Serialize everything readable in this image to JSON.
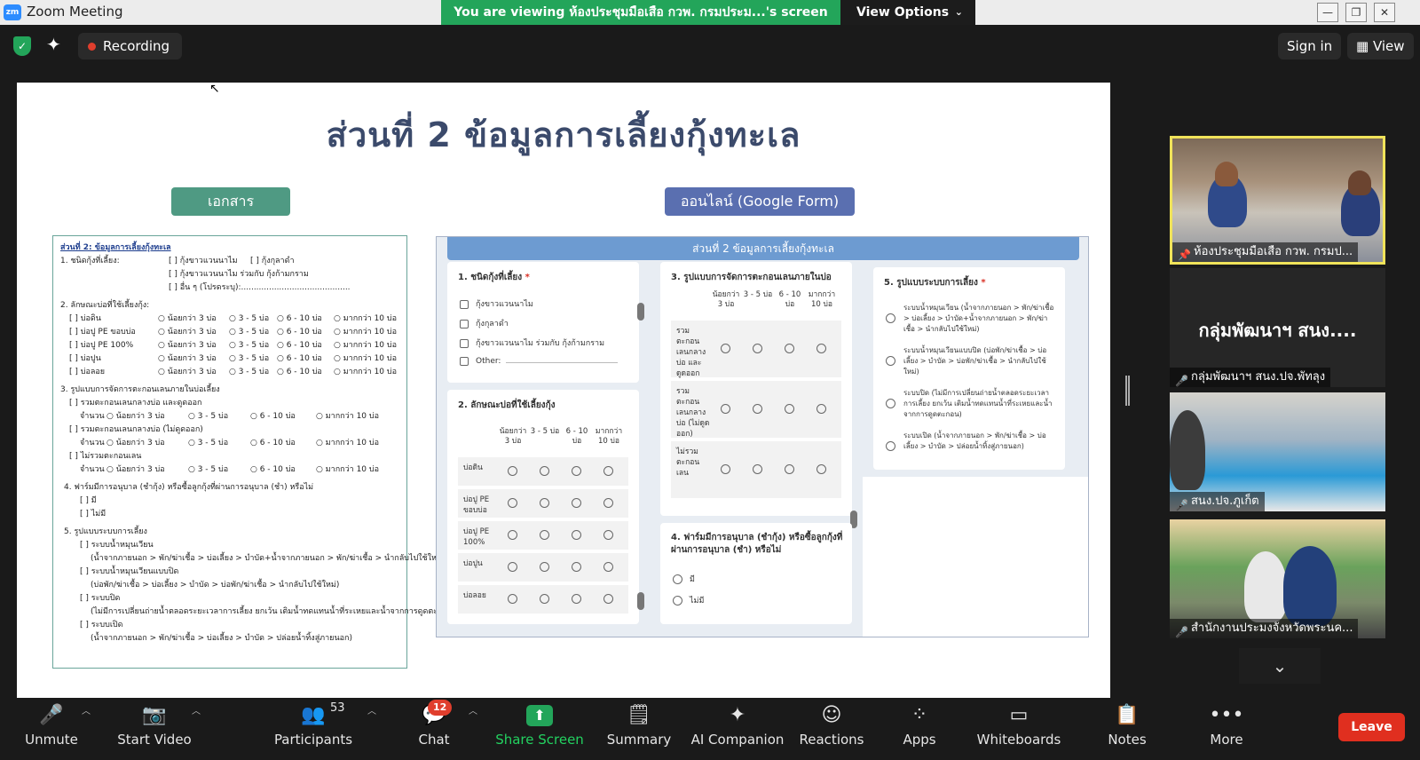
{
  "window": {
    "title": "Zoom Meeting",
    "banner": "You are viewing ห้องประชุมมือเสือ กวพ. กรมประม...'s screen",
    "view_options": "View Options"
  },
  "topbar": {
    "recording": "Recording",
    "sign_in": "Sign in",
    "view": "View"
  },
  "slide": {
    "title": "ส่วนที่ 2  ข้อมูลการเลี้ยงกุ้งทะเล",
    "pill_doc": "เอกสาร",
    "pill_online": "ออนไลน์ (Google Form)",
    "paper": {
      "heading": "ส่วนที่ 2:  ข้อมูลการเลี้ยงกุ้งทะเล",
      "q1": "1. ชนิดกุ้งที่เลี้ยง:",
      "q1_opt1": "[ ] กุ้งขาวแวนนาไม",
      "q1_opt2": "[ ] กุ้งกุลาดำ",
      "q1_opt3": "[ ] กุ้งขาวแวนนาไม ร่วมกับ กุ้งก้ามกราม",
      "q1_opt4": "[ ] อื่น ๆ (โปรดระบุ):...........................................",
      "q2": "2. ลักษณะบ่อที่ใช้เลี้ยงกุ้ง:",
      "q2_rows": [
        "[ ] บ่อดิน",
        "[ ] บ่อปู PE ขอบบ่อ",
        "[ ] บ่อปู PE 100%",
        "[ ] บ่อปูน",
        "[ ] บ่อลอย"
      ],
      "q2_scale": [
        "○ น้อยกว่า 3 บ่อ",
        "○ 3 - 5 บ่อ",
        "○ 6 - 10 บ่อ",
        "○ มากกว่า 10 บ่อ"
      ],
      "q3": "3. รูปแบบการจัดการตะกอนเลนภายในบ่อเลี้ยง",
      "q3_a": "[ ] รวมตะกอนเลนกลางบ่อ และดูดออก",
      "q3_b": "[ ] รวมตะกอนเลนกลางบ่อ (ไม่ดูดออก)",
      "q3_c": "[ ] ไม่รวมตะกอนเลน",
      "q3_count": "จำนวน",
      "q4": "4. ฟาร์มมีการอนุบาล (ชำกุ้ง) หรือซื้อลูกกุ้งที่ผ่านการอนุบาล (ชำ) หรือไม่",
      "q4_yes": "[ ] มี",
      "q4_no": "[ ] ไม่มี",
      "q5": "5. รูปแบบระบบการเลี้ยง",
      "q5_a": "[ ] ระบบน้ำหมุนเวียน",
      "q5_a_desc": "(น้ำจากภายนอก > พัก/ฆ่าเชื้อ > บ่อเลี้ยง > บำบัด+น้ำจากภายนอก > พัก/ฆ่าเชื้อ > นำกลับไปใช้ใหม่)",
      "q5_b": "[ ] ระบบน้ำหมุนเวียนแบบปิด",
      "q5_b_desc": "(บ่อพัก/ฆ่าเชื้อ > บ่อเลี้ยง > บำบัด > บ่อพัก/ฆ่าเชื้อ > นำกลับไปใช้ใหม่)",
      "q5_c": "[ ] ระบบปิด",
      "q5_c_desc": "(ไม่มีการเปลี่ยนถ่ายน้ำตลอดระยะเวลาการเลี้ยง ยกเว้น เติมน้ำทดแทนน้ำที่ระเหยและน้ำจากการดูดตะกอน)",
      "q5_d": "[ ] ระบบเปิด",
      "q5_d_desc": "(น้ำจากภายนอก > พัก/ฆ่าเชื้อ > บ่อเลี้ยง > บำบัด > ปล่อยน้ำทิ้งสู่ภายนอก)"
    },
    "gform": {
      "header": "ส่วนที่ 2  ข้อมูลการเลี้ยงกุ้งทะเล",
      "c1_title": "1. ชนิดกุ้งที่เลี้ยง",
      "c1_opts": [
        "กุ้งขาวแวนนาไม",
        "กุ้งกุลาดำ",
        "กุ้งขาวแวนนาไม ร่วมกับ กุ้งก้ามกราม",
        "Other:"
      ],
      "c2_title": "2. ลักษณะบ่อที่ใช้เลี้ยงกุ้ง",
      "c2_cols": [
        "น้อยกว่า 3 บ่อ",
        "3 - 5 บ่อ",
        "6 - 10 บ่อ",
        "มากกว่า 10 บ่อ"
      ],
      "c2_rows": [
        "บ่อดิน",
        "บ่อปู PE ขอบบ่อ",
        "บ่อปู PE 100%",
        "บ่อปูน",
        "บ่อลอย"
      ],
      "c3_title": "3. รูปแบบการจัดการตะกอนเลนภายในบ่อ",
      "c3_cols": [
        "น้อยกว่า 3 บ่อ",
        "3 - 5 บ่อ",
        "6 - 10 บ่อ",
        "มากกว่า 10 บ่อ"
      ],
      "c3_rows": [
        "รวมตะกอนเลนกลางบ่อ และดูดออก",
        "รวมตะกอนเลนกลางบ่อ (ไม่ดูดออก)",
        "ไม่รวมตะกอนเลน"
      ],
      "c4_title": "4. ฟาร์มมีการอนุบาล (ชำกุ้ง) หรือซื้อลูกกุ้งที่ผ่านการอนุบาล (ชำ) หรือไม่",
      "c4_opts": [
        "มี",
        "ไม่มี"
      ],
      "c5_title": "5. รูปแบบระบบการเลี้ยง",
      "c5_opts": [
        "ระบบน้ำหมุนเวียน (น้ำจากภายนอก > พัก/ฆ่าเชื้อ > บ่อเลี้ยง > บำบัด+น้ำจากภายนอก > พัก/ฆ่าเชื้อ > นำกลับไปใช้ใหม่)",
        "ระบบน้ำหมุนเวียนแบบปิด (บ่อพัก/ฆ่าเชื้อ > บ่อเลี้ยง > บำบัด > บ่อพัก/ฆ่าเชื้อ > นำกลับไปใช้ใหม่)",
        "ระบบปิด (ไม่มีการเปลี่ยนถ่ายน้ำตลอดระยะเวลาการเลี้ยง ยกเว้น เติมน้ำทดแทนน้ำที่ระเหยและน้ำจากการดูดตะกอน)",
        "ระบบเปิด (น้ำจากภายนอก > พัก/ฆ่าเชื้อ > บ่อเลี้ยง > บำบัด > ปล่อยน้ำทิ้งสู่ภายนอก)"
      ]
    }
  },
  "participants_panel": {
    "tile1_name": "ห้องประชุมมือเสือ กวพ. กรมป...",
    "tile2_big": "กลุ่มพัฒนาฯ สนง....",
    "tile2_name": "กลุ่มพัฒนาฯ สนง.ปจ.พัทลุง",
    "tile3_name": "สนง.ปจ.ภูเก็ต",
    "tile4_name": "สำนักงานประมงจังหวัดพระนค..."
  },
  "toolbar": {
    "unmute": "Unmute",
    "start_video": "Start Video",
    "participants": "Participants",
    "participants_count": "53",
    "chat": "Chat",
    "chat_badge": "12",
    "share_screen": "Share Screen",
    "summary": "Summary",
    "ai_companion": "AI Companion",
    "reactions": "Reactions",
    "apps": "Apps",
    "whiteboards": "Whiteboards",
    "notes": "Notes",
    "more": "More",
    "leave": "Leave"
  },
  "colors": {
    "banner_green": "#23a55a",
    "leave_red": "#e02f1f",
    "gform_blue": "#6d9bd1",
    "pill_green": "#4f9a83",
    "pill_blue": "#5a6fb0"
  }
}
